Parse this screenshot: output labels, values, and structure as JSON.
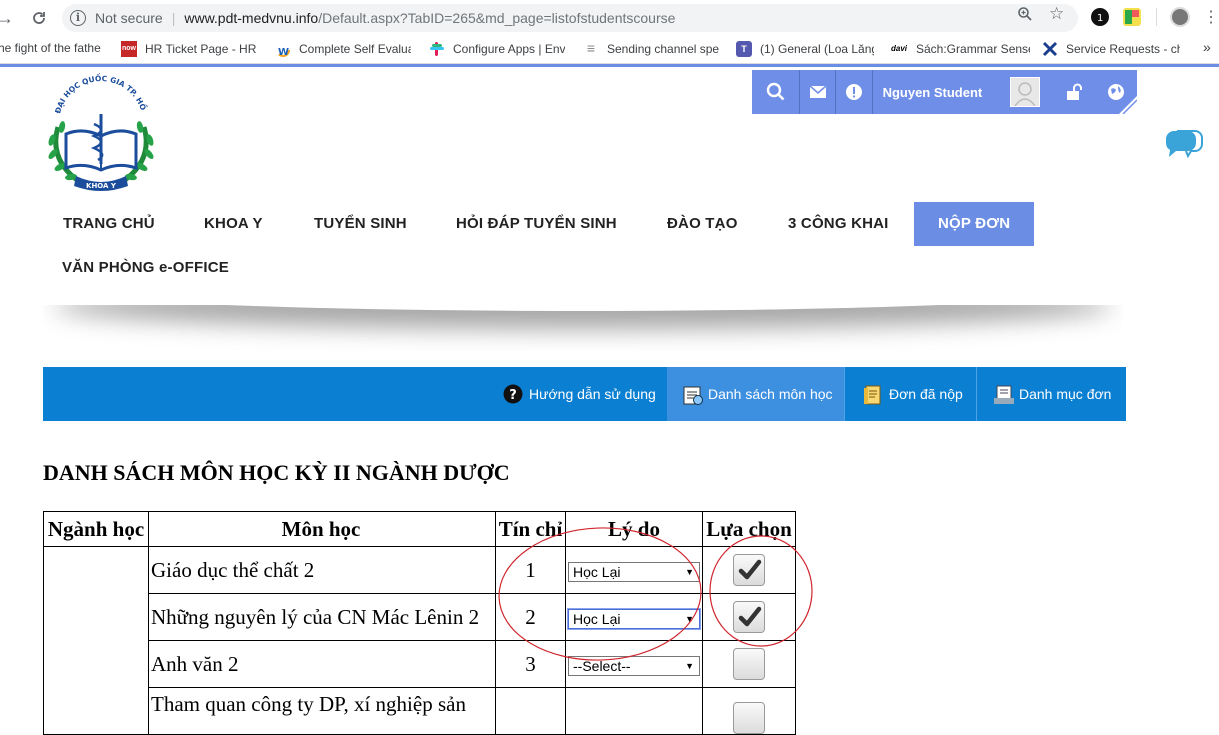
{
  "browser": {
    "security_label": "Not secure",
    "url_domain": "www.pdt-medvnu.info",
    "url_path": "/Default.aspx?TabID=265&md_page=listofstudentscourse",
    "bookmarks": [
      {
        "label": "he fight of the fathe"
      },
      {
        "label": "HR Ticket Page - HR ;"
      },
      {
        "label": "Complete Self Evalua"
      },
      {
        "label": "Configure Apps | Env"
      },
      {
        "label": "Sending channel spe"
      },
      {
        "label": "(1) General (Loa Lăng"
      },
      {
        "label": "Sách:Grammar Sense"
      },
      {
        "label": "Service Requests - ch"
      }
    ],
    "bookmark_fav_now": "now",
    "bookmark_fav_davi": "davi",
    "more_bookmarks": "»"
  },
  "userbar": {
    "name": "Nguyen Student"
  },
  "logo": {
    "top_text": "ĐẠI HỌC QUỐC GIA TP. HỒ CHÍ MINH",
    "bottom_text": "KHOA Y"
  },
  "nav": {
    "items": [
      {
        "label": "TRANG CHỦ"
      },
      {
        "label": "KHOA Y"
      },
      {
        "label": "TUYỂN SINH"
      },
      {
        "label": "HỎI ĐÁP TUYỂN SINH"
      },
      {
        "label": "ĐÀO TẠO"
      },
      {
        "label": "3 CÔNG KHAI"
      },
      {
        "label": "NỘP ĐƠN"
      },
      {
        "label": "VĂN PHÒNG e-OFFICE"
      }
    ],
    "active_index": 6
  },
  "tabs": [
    {
      "label": "Hướng dẫn sử dụng"
    },
    {
      "label": "Danh sách môn học"
    },
    {
      "label": "Đơn đã nộp"
    },
    {
      "label": "Danh mục đơn"
    }
  ],
  "content": {
    "heading": "DANH SÁCH MÔN HỌC KỲ II NGÀNH DƯỢC",
    "columns": [
      "Ngành học",
      "Môn học",
      "Tín chỉ",
      "Lý do",
      "Lựa chọn"
    ],
    "rows": [
      {
        "nganh": "",
        "mon": "Giáo dục thể chất 2",
        "tin_chi": "1",
        "ly_do": "Học Lại",
        "checked": true
      },
      {
        "nganh": "",
        "mon": "Những nguyên lý của CN Mác Lênin 2",
        "tin_chi": "2",
        "ly_do": "Học Lại",
        "checked": true
      },
      {
        "nganh": "",
        "mon": "Anh văn 2",
        "tin_chi": "3",
        "ly_do": "--Select--",
        "checked": false
      },
      {
        "nganh": "",
        "mon": "Tham quan công ty DP, xí nghiệp sản",
        "tin_chi": "",
        "ly_do": "",
        "checked": false
      }
    ]
  },
  "colors": {
    "accent": "#6b8de3",
    "tabbar": "#0b7fd1",
    "annotation": "#d0262e"
  }
}
